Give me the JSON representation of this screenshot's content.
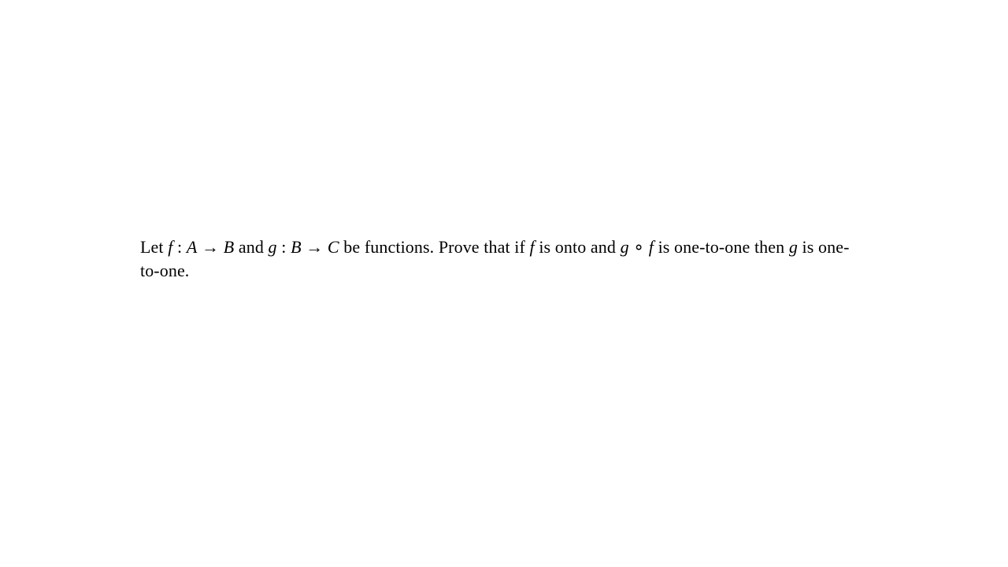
{
  "problem": {
    "w_let": "Let ",
    "f": "f",
    "colon1": " : ",
    "A": "A",
    "arrow1": " → ",
    "B": "B",
    "w_and": " and ",
    "g": "g",
    "colon2": " : ",
    "B2": "B",
    "arrow2": " → ",
    "C": "C",
    "w_befns": " be functions. Prove that if ",
    "f2": "f",
    "w_onto": " is onto and ",
    "g2": "g",
    "compose": " ∘ ",
    "f3": "f",
    "w_injthen": " is one-to-one then ",
    "g3": "g",
    "w_inj": " is one-to-one."
  }
}
